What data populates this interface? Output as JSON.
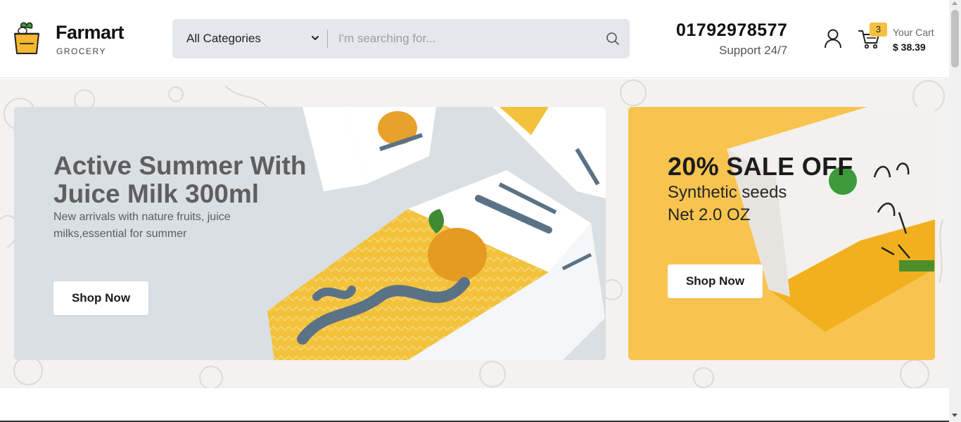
{
  "brand": {
    "name": "Farmart",
    "tagline": "GROCERY"
  },
  "search": {
    "category": "All Categories",
    "placeholder": "I'm searching for..."
  },
  "contact": {
    "phone": "01792978577",
    "support": "Support 24/7"
  },
  "cart": {
    "count": "3",
    "label": "Your Cart",
    "total": "$ 38.39"
  },
  "banners": {
    "main": {
      "title": "Active Summer With Juice Milk 300ml",
      "description": "New arrivals with nature fruits, juice milks,essential for summer",
      "button": "Shop Now"
    },
    "side": {
      "title": "20% SALE OFF",
      "line1": "Synthetic seeds",
      "line2": "Net 2.0 OZ",
      "button": "Shop Now"
    }
  },
  "colors": {
    "accent": "#f8c44f",
    "main_banner_bg": "#d9dfe3",
    "search_bg": "#e4e7eb"
  },
  "icons": [
    "grocery-bag-logo-icon",
    "chevron-down-icon",
    "search-icon",
    "user-icon",
    "cart-icon"
  ]
}
